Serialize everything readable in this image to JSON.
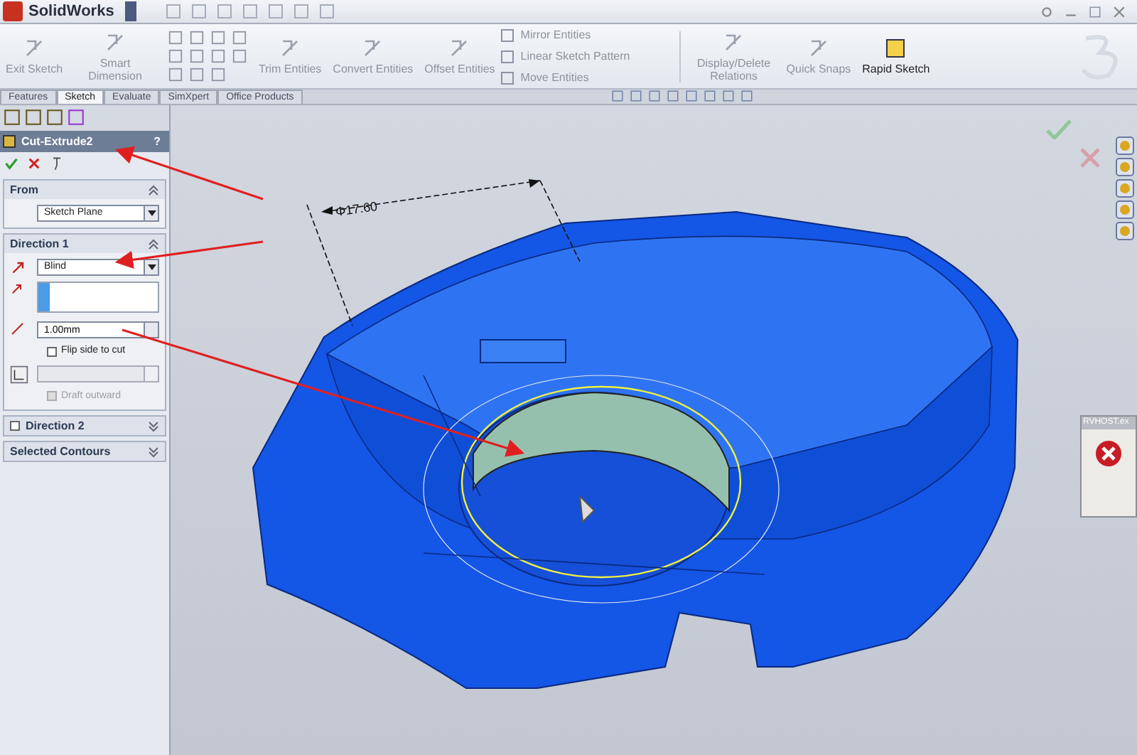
{
  "app": {
    "title": "SolidWorks"
  },
  "ribbon": {
    "large_tools": [
      {
        "label": "Exit Sketch",
        "disabled": true
      },
      {
        "label": "Smart Dimension",
        "disabled": true
      }
    ],
    "entity_tools": [
      {
        "label": "Trim Entities",
        "disabled": true
      },
      {
        "label": "Convert Entities",
        "disabled": true
      },
      {
        "label": "Offset Entities",
        "disabled": true
      }
    ],
    "pattern_tools": [
      {
        "label": "Mirror Entities",
        "disabled": true
      },
      {
        "label": "Linear Sketch Pattern",
        "disabled": true
      },
      {
        "label": "Move Entities",
        "disabled": true
      }
    ],
    "relation_tools": [
      {
        "label": "Display/Delete Relations",
        "disabled": true
      },
      {
        "label": "Quick Snaps",
        "disabled": true
      },
      {
        "label": "Rapid Sketch",
        "disabled": false
      }
    ]
  },
  "tabs": [
    {
      "label": "Features",
      "selected": false
    },
    {
      "label": "Sketch",
      "selected": true
    },
    {
      "label": "Evaluate",
      "selected": false
    },
    {
      "label": "SimXpert",
      "selected": false
    },
    {
      "label": "Office Products",
      "selected": false
    }
  ],
  "property_manager": {
    "title": "Cut-Extrude2",
    "help": "?",
    "from": {
      "title": "From",
      "expanded": true,
      "value": "Sketch Plane"
    },
    "direction1": {
      "title": "Direction 1",
      "expanded": true,
      "end_condition": "Blind",
      "depth": "1.00mm",
      "flip": {
        "label": "Flip side to cut",
        "checked": false
      },
      "draft": {
        "label": "Draft outward",
        "checked": false,
        "disabled": true
      }
    },
    "direction2": {
      "title": "Direction 2",
      "checked": false,
      "expanded": false
    },
    "contours": {
      "title": "Selected Contours",
      "expanded": false
    }
  },
  "viewport": {
    "dimension": "Φ17.60"
  },
  "dialog": {
    "title": "RVHOST.ex"
  }
}
